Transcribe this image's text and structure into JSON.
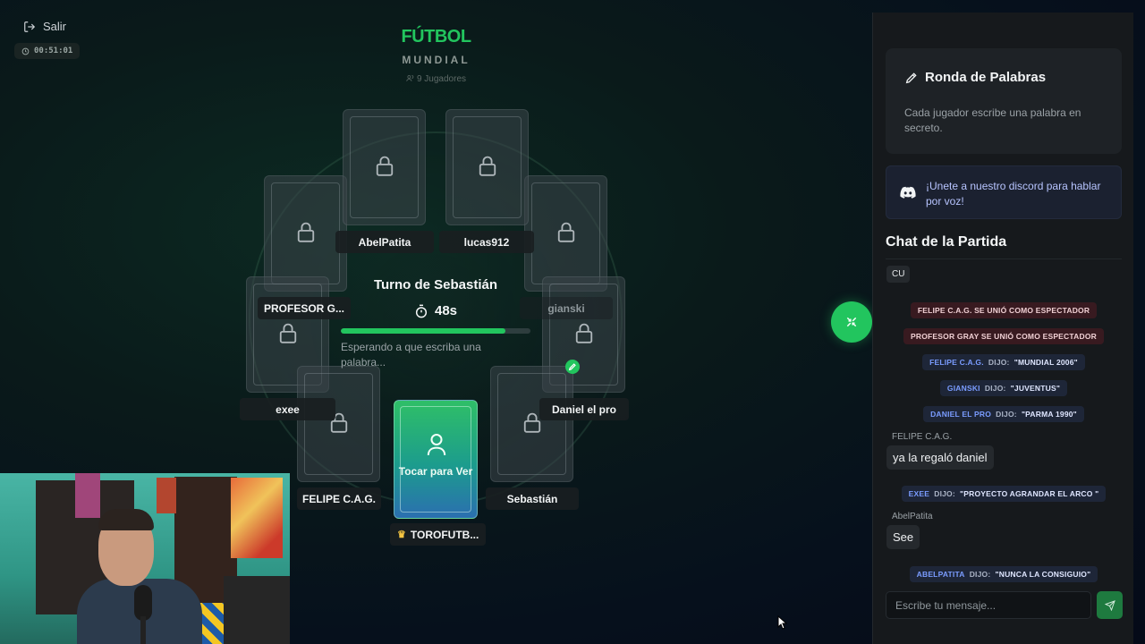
{
  "header": {
    "exit_label": "Salir",
    "elapsed": "00:51:01",
    "game_title": "FÚTBOL",
    "game_subtitle": "MUNDIAL",
    "players_count": "9 Jugadores"
  },
  "table": {
    "players": [
      {
        "name": "AbelPatita"
      },
      {
        "name": "lucas912"
      },
      {
        "name": "PROFESOR G..."
      },
      {
        "name": "gianski"
      },
      {
        "name": "exee"
      },
      {
        "name": "Daniel el pro"
      },
      {
        "name": "FELIPE C.A.G."
      },
      {
        "name": "Sebastián"
      }
    ],
    "me": {
      "name": "TOROFUTB...",
      "card_text": "Tocar para Ver"
    },
    "turn": {
      "title": "Turno de Sebastián",
      "seconds": "48s",
      "progress": 0.87,
      "status": "Esperando a que escriba una palabra..."
    }
  },
  "sidebar": {
    "round_title": "Ronda de Palabras",
    "round_desc": "Cada jugador escribe una palabra en secreto.",
    "discord_text": "¡Unete a nuestro discord para hablar por voz!",
    "chat_title": "Chat de la Partida",
    "messages": [
      {
        "type": "bubble",
        "text": "CU"
      },
      {
        "type": "system",
        "text": "FELIPE C.A.G. SE UNIÓ COMO ESPECTADOR"
      },
      {
        "type": "system",
        "text": "PROFESOR GRAY SE UNIÓ COMO ESPECTADOR"
      },
      {
        "type": "said",
        "who": "FELIPE C.A.G.",
        "verb": "DIJO:",
        "word": "\"MUNDIAL 2006\""
      },
      {
        "type": "said",
        "who": "GIANSKI",
        "verb": "DIJO:",
        "word": "\"JUVENTUS\""
      },
      {
        "type": "said",
        "who": "DANIEL EL PRO",
        "verb": "DIJO:",
        "word": "\"PARMA 1990\""
      },
      {
        "type": "chat",
        "author": "FELIPE C.A.G.",
        "text": "ya la regaló daniel"
      },
      {
        "type": "said",
        "who": "EXEE",
        "verb": "DIJO:",
        "word": "\"PROYECTO AGRANDAR EL ARCO \""
      },
      {
        "type": "chat",
        "author": "AbelPatita",
        "text": "See"
      },
      {
        "type": "said",
        "who": "ABELPATITA",
        "verb": "DIJO:",
        "word": "\"NUNCA LA CONSIGUIO\""
      }
    ],
    "input_placeholder": "Escribe tu mensaje..."
  },
  "colors": {
    "accent": "#22c55e",
    "discord": "#b7c4ff"
  }
}
